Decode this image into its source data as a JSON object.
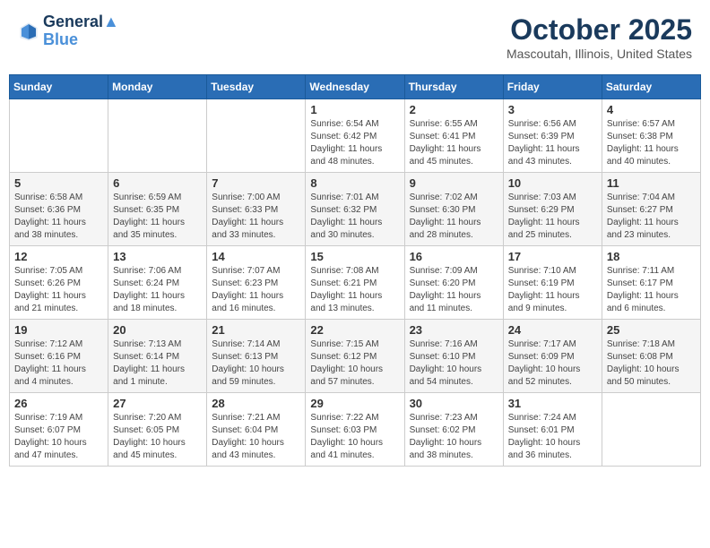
{
  "header": {
    "logo_line1": "General",
    "logo_line2": "Blue",
    "month": "October 2025",
    "location": "Mascoutah, Illinois, United States"
  },
  "days_of_week": [
    "Sunday",
    "Monday",
    "Tuesday",
    "Wednesday",
    "Thursday",
    "Friday",
    "Saturday"
  ],
  "weeks": [
    [
      {
        "day": "",
        "info": ""
      },
      {
        "day": "",
        "info": ""
      },
      {
        "day": "",
        "info": ""
      },
      {
        "day": "1",
        "info": "Sunrise: 6:54 AM\nSunset: 6:42 PM\nDaylight: 11 hours\nand 48 minutes."
      },
      {
        "day": "2",
        "info": "Sunrise: 6:55 AM\nSunset: 6:41 PM\nDaylight: 11 hours\nand 45 minutes."
      },
      {
        "day": "3",
        "info": "Sunrise: 6:56 AM\nSunset: 6:39 PM\nDaylight: 11 hours\nand 43 minutes."
      },
      {
        "day": "4",
        "info": "Sunrise: 6:57 AM\nSunset: 6:38 PM\nDaylight: 11 hours\nand 40 minutes."
      }
    ],
    [
      {
        "day": "5",
        "info": "Sunrise: 6:58 AM\nSunset: 6:36 PM\nDaylight: 11 hours\nand 38 minutes."
      },
      {
        "day": "6",
        "info": "Sunrise: 6:59 AM\nSunset: 6:35 PM\nDaylight: 11 hours\nand 35 minutes."
      },
      {
        "day": "7",
        "info": "Sunrise: 7:00 AM\nSunset: 6:33 PM\nDaylight: 11 hours\nand 33 minutes."
      },
      {
        "day": "8",
        "info": "Sunrise: 7:01 AM\nSunset: 6:32 PM\nDaylight: 11 hours\nand 30 minutes."
      },
      {
        "day": "9",
        "info": "Sunrise: 7:02 AM\nSunset: 6:30 PM\nDaylight: 11 hours\nand 28 minutes."
      },
      {
        "day": "10",
        "info": "Sunrise: 7:03 AM\nSunset: 6:29 PM\nDaylight: 11 hours\nand 25 minutes."
      },
      {
        "day": "11",
        "info": "Sunrise: 7:04 AM\nSunset: 6:27 PM\nDaylight: 11 hours\nand 23 minutes."
      }
    ],
    [
      {
        "day": "12",
        "info": "Sunrise: 7:05 AM\nSunset: 6:26 PM\nDaylight: 11 hours\nand 21 minutes."
      },
      {
        "day": "13",
        "info": "Sunrise: 7:06 AM\nSunset: 6:24 PM\nDaylight: 11 hours\nand 18 minutes."
      },
      {
        "day": "14",
        "info": "Sunrise: 7:07 AM\nSunset: 6:23 PM\nDaylight: 11 hours\nand 16 minutes."
      },
      {
        "day": "15",
        "info": "Sunrise: 7:08 AM\nSunset: 6:21 PM\nDaylight: 11 hours\nand 13 minutes."
      },
      {
        "day": "16",
        "info": "Sunrise: 7:09 AM\nSunset: 6:20 PM\nDaylight: 11 hours\nand 11 minutes."
      },
      {
        "day": "17",
        "info": "Sunrise: 7:10 AM\nSunset: 6:19 PM\nDaylight: 11 hours\nand 9 minutes."
      },
      {
        "day": "18",
        "info": "Sunrise: 7:11 AM\nSunset: 6:17 PM\nDaylight: 11 hours\nand 6 minutes."
      }
    ],
    [
      {
        "day": "19",
        "info": "Sunrise: 7:12 AM\nSunset: 6:16 PM\nDaylight: 11 hours\nand 4 minutes."
      },
      {
        "day": "20",
        "info": "Sunrise: 7:13 AM\nSunset: 6:14 PM\nDaylight: 11 hours\nand 1 minute."
      },
      {
        "day": "21",
        "info": "Sunrise: 7:14 AM\nSunset: 6:13 PM\nDaylight: 10 hours\nand 59 minutes."
      },
      {
        "day": "22",
        "info": "Sunrise: 7:15 AM\nSunset: 6:12 PM\nDaylight: 10 hours\nand 57 minutes."
      },
      {
        "day": "23",
        "info": "Sunrise: 7:16 AM\nSunset: 6:10 PM\nDaylight: 10 hours\nand 54 minutes."
      },
      {
        "day": "24",
        "info": "Sunrise: 7:17 AM\nSunset: 6:09 PM\nDaylight: 10 hours\nand 52 minutes."
      },
      {
        "day": "25",
        "info": "Sunrise: 7:18 AM\nSunset: 6:08 PM\nDaylight: 10 hours\nand 50 minutes."
      }
    ],
    [
      {
        "day": "26",
        "info": "Sunrise: 7:19 AM\nSunset: 6:07 PM\nDaylight: 10 hours\nand 47 minutes."
      },
      {
        "day": "27",
        "info": "Sunrise: 7:20 AM\nSunset: 6:05 PM\nDaylight: 10 hours\nand 45 minutes."
      },
      {
        "day": "28",
        "info": "Sunrise: 7:21 AM\nSunset: 6:04 PM\nDaylight: 10 hours\nand 43 minutes."
      },
      {
        "day": "29",
        "info": "Sunrise: 7:22 AM\nSunset: 6:03 PM\nDaylight: 10 hours\nand 41 minutes."
      },
      {
        "day": "30",
        "info": "Sunrise: 7:23 AM\nSunset: 6:02 PM\nDaylight: 10 hours\nand 38 minutes."
      },
      {
        "day": "31",
        "info": "Sunrise: 7:24 AM\nSunset: 6:01 PM\nDaylight: 10 hours\nand 36 minutes."
      },
      {
        "day": "",
        "info": ""
      }
    ]
  ]
}
